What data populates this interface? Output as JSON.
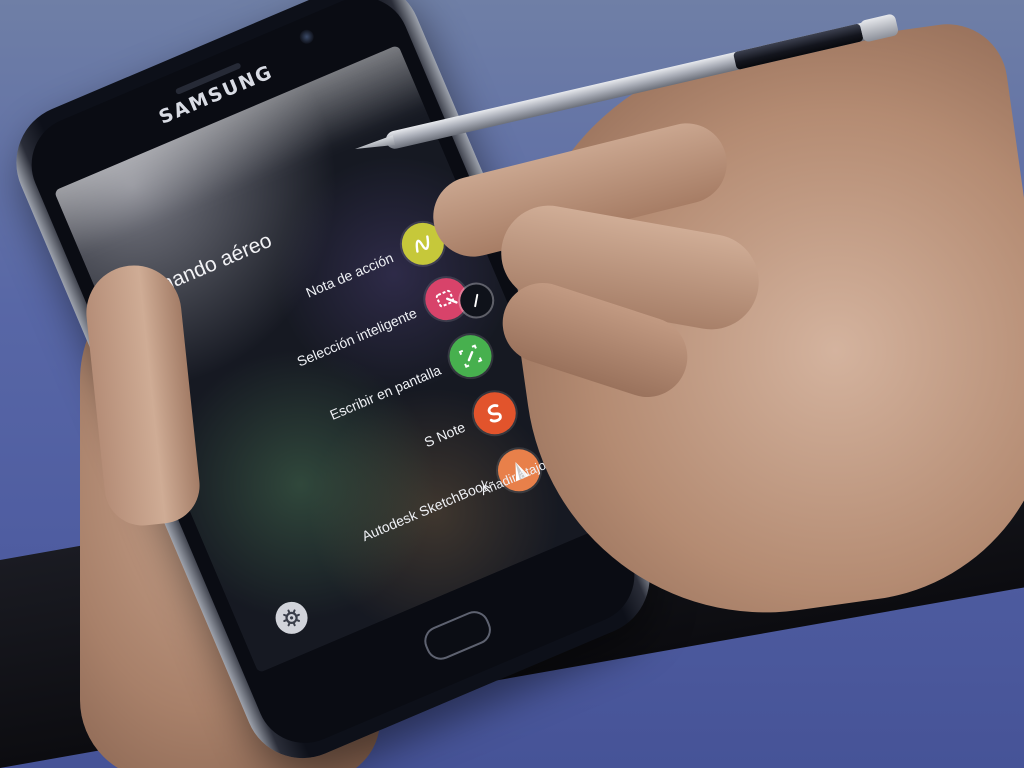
{
  "device": {
    "brand": "SAMSUNG"
  },
  "air_command": {
    "title": "Comando aéreo",
    "items": [
      {
        "label": "Nota de acción",
        "icon": "action-memo-icon",
        "color": "#c6c83a"
      },
      {
        "label": "Selección inteligente",
        "icon": "smart-select-icon",
        "color": "#d8436a"
      },
      {
        "label": "Escribir en pantalla",
        "icon": "screen-write-icon",
        "color": "#47b04e"
      },
      {
        "label": "S Note",
        "icon": "s-note-icon",
        "color": "#e2542c"
      },
      {
        "label": "Autodesk SketchBook",
        "icon": "sketchbook-icon",
        "color": "#e8804a"
      }
    ],
    "add_shortcut": {
      "label": "Añadir atajos",
      "icon": "plus-icon"
    }
  },
  "controls": {
    "pen_handle_icon": "pen-icon",
    "settings_icon": "gear-icon"
  },
  "colors": {
    "background_blue": "#5867a6",
    "phone_body": "#0d1019",
    "screen_text": "#eef0f4"
  }
}
